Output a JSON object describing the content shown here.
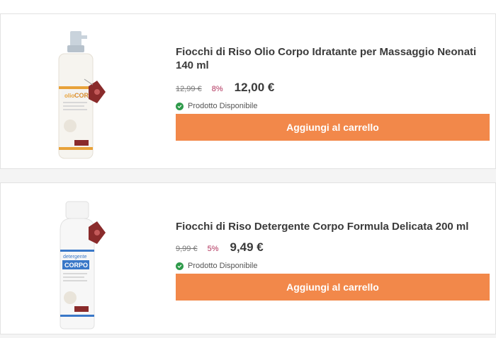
{
  "products": [
    {
      "title": "Fiocchi di Riso Olio Corpo Idratante per Massaggio Neonati 140 ml",
      "old_price": "12,99 €",
      "discount": "8%",
      "price": "12,00 €",
      "availability": "Prodotto Disponibile",
      "button_label": "Aggiungi al carrello",
      "image_icon": "product-bottle-spray-icon",
      "label_word": "CORPO"
    },
    {
      "title": "Fiocchi di Riso Detergente Corpo Formula Delicata 200 ml",
      "old_price": "9,99 €",
      "discount": "5%",
      "price": "9,49 €",
      "availability": "Prodotto Disponibile",
      "button_label": "Aggiungi al carrello",
      "image_icon": "product-bottle-cap-icon",
      "label_word": "CORPO"
    }
  ],
  "colors": {
    "accent": "#f2884a",
    "discount": "#b0305a",
    "available": "#2e9a4a"
  }
}
